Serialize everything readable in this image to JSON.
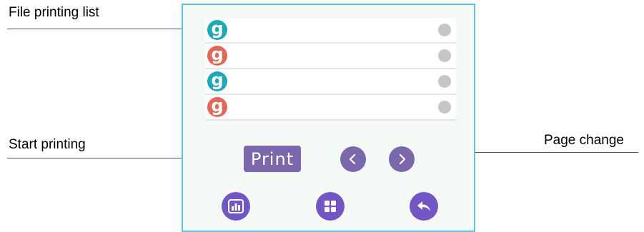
{
  "annotations": {
    "file_list": "File printing list",
    "start_printing": "Start printing",
    "page_change": "Page change"
  },
  "files": [
    {
      "icon_letter": "g",
      "color": "#1fa9b8"
    },
    {
      "icon_letter": "g",
      "color": "#e2685a"
    },
    {
      "icon_letter": "g",
      "color": "#1fa9b8"
    },
    {
      "icon_letter": "g",
      "color": "#e2685a"
    }
  ],
  "print_button": {
    "label": "Print"
  },
  "navigation": {
    "prev_icon": "chevron-left-icon",
    "next_icon": "chevron-right-icon"
  },
  "toolbar": {
    "icons": [
      "bar-chart-icon",
      "grid-icon",
      "back-arrow-icon"
    ]
  },
  "colors": {
    "accent": "#7b67ac",
    "border": "#5cc4dc",
    "teal": "#1fa9b8",
    "coral": "#e2685a"
  }
}
